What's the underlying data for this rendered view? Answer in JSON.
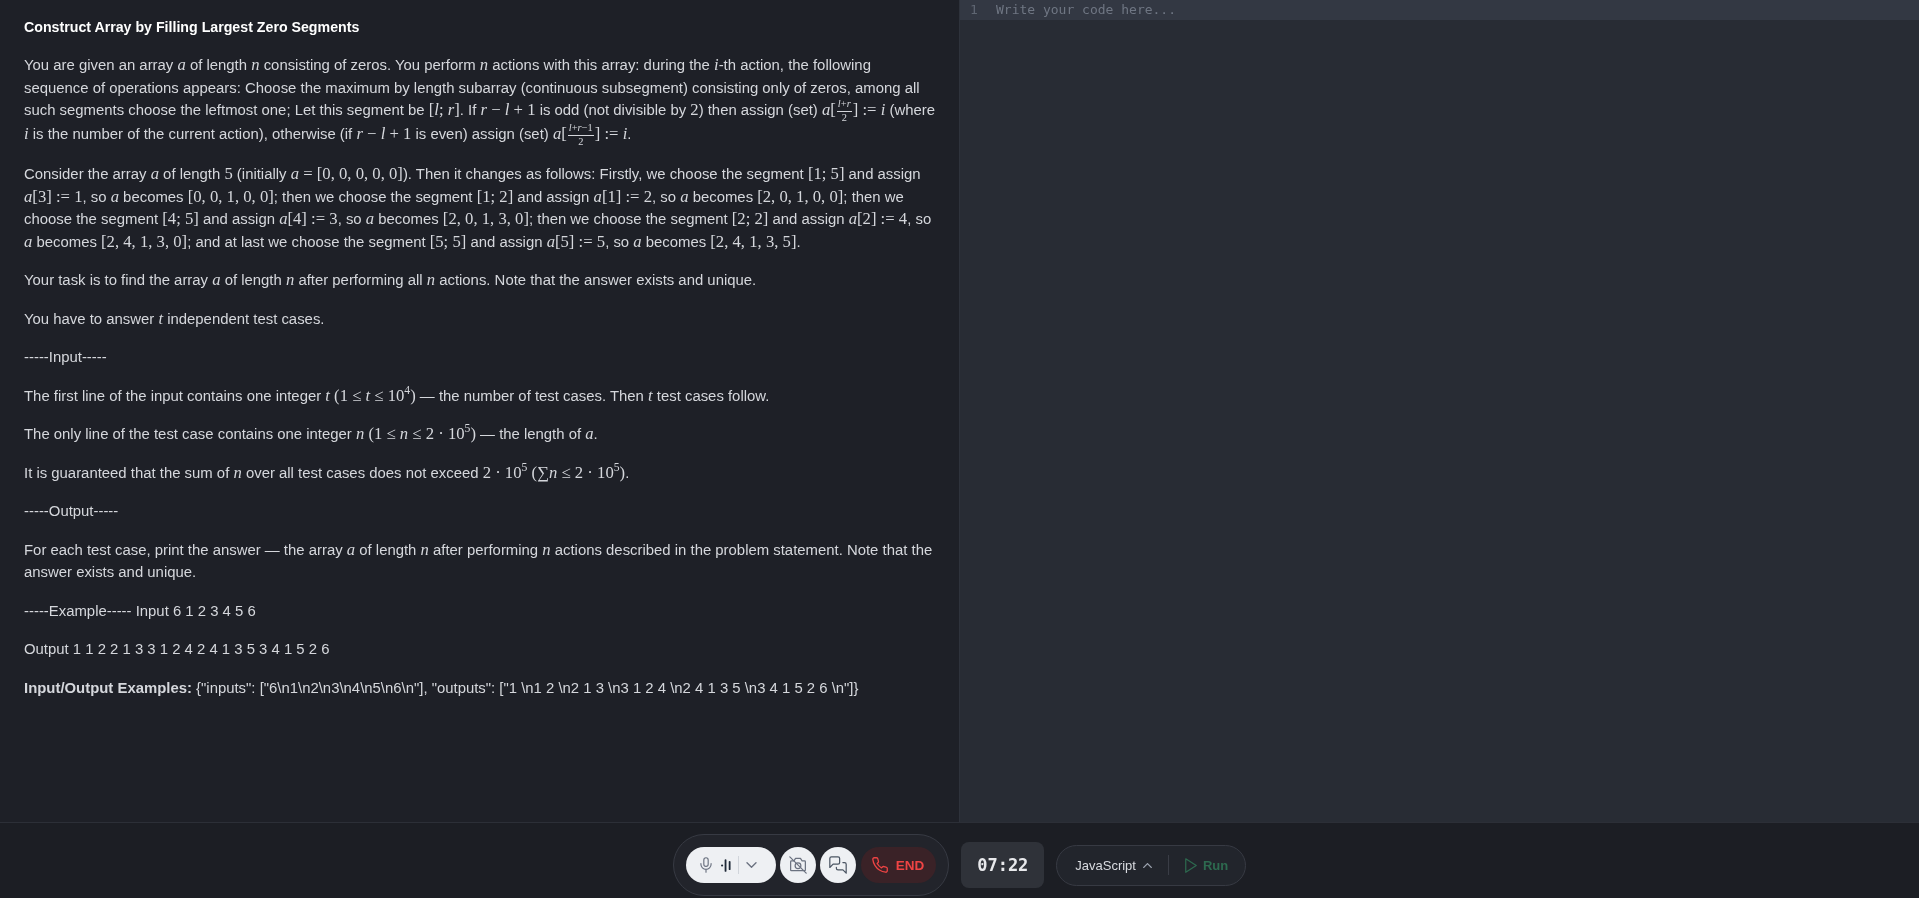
{
  "problem": {
    "title": "Construct Array by Filling Largest Zero Segments",
    "paragraphs": [
      {
        "parts": [
          {
            "kind": "text",
            "text": "You are given an array "
          },
          {
            "kind": "math",
            "text": "*a*"
          },
          {
            "kind": "text",
            "text": " of length "
          },
          {
            "kind": "math",
            "text": "*n*"
          },
          {
            "kind": "text",
            "text": " consisting of zeros. You perform "
          },
          {
            "kind": "math",
            "text": "*n*"
          },
          {
            "kind": "text",
            "text": " actions with this array: during the "
          },
          {
            "kind": "math",
            "text": "*i*"
          },
          {
            "kind": "text",
            "text": "-th action, the following sequence of operations appears: Choose the maximum by length subarray (continuous subsegment) consisting only of zeros, among all such segments choose the leftmost one; Let this segment be "
          },
          {
            "kind": "math",
            "text": "[*l*; *r*]"
          },
          {
            "kind": "text",
            "text": ". If "
          },
          {
            "kind": "math",
            "text": "*r* − *l* + 1"
          },
          {
            "kind": "text",
            "text": " is odd (not divisible by "
          },
          {
            "kind": "math",
            "text": "2"
          },
          {
            "kind": "text",
            "text": ") then assign (set) "
          },
          {
            "kind": "math",
            "text": "*a*["
          },
          {
            "kind": "frac",
            "numerator": "*l*+*r*",
            "denominator": "2"
          },
          {
            "kind": "math",
            "text": "] := *i*"
          },
          {
            "kind": "text",
            "text": " (where "
          },
          {
            "kind": "math",
            "text": "*i*"
          },
          {
            "kind": "text",
            "text": " is the number of the current action), otherwise (if "
          },
          {
            "kind": "math",
            "text": "*r* − *l* + 1"
          },
          {
            "kind": "text",
            "text": " is even) assign (set) "
          },
          {
            "kind": "math",
            "text": "*a*["
          },
          {
            "kind": "frac",
            "numerator": "*l*+*r*−1",
            "denominator": "2"
          },
          {
            "kind": "math",
            "text": "] := *i*"
          },
          {
            "kind": "text",
            "text": "."
          }
        ]
      },
      {
        "parts": [
          {
            "kind": "text",
            "text": "Consider the array "
          },
          {
            "kind": "math",
            "text": "*a*"
          },
          {
            "kind": "text",
            "text": " of length "
          },
          {
            "kind": "math",
            "text": "5"
          },
          {
            "kind": "text",
            "text": " (initially "
          },
          {
            "kind": "math",
            "text": "*a* = [0, 0, 0, 0, 0]"
          },
          {
            "kind": "text",
            "text": "). Then it changes as follows: Firstly, we choose the segment "
          },
          {
            "kind": "math",
            "text": "[1; 5]"
          },
          {
            "kind": "text",
            "text": " and assign "
          },
          {
            "kind": "math",
            "text": "*a*[3] := 1"
          },
          {
            "kind": "text",
            "text": ", so "
          },
          {
            "kind": "math",
            "text": "*a*"
          },
          {
            "kind": "text",
            "text": " becomes "
          },
          {
            "kind": "math",
            "text": "[0, 0, 1, 0, 0]"
          },
          {
            "kind": "text",
            "text": "; then we choose the segment "
          },
          {
            "kind": "math",
            "text": "[1; 2]"
          },
          {
            "kind": "text",
            "text": " and assign "
          },
          {
            "kind": "math",
            "text": "*a*[1] := 2"
          },
          {
            "kind": "text",
            "text": ", so "
          },
          {
            "kind": "math",
            "text": "*a*"
          },
          {
            "kind": "text",
            "text": " becomes "
          },
          {
            "kind": "math",
            "text": "[2, 0, 1, 0, 0]"
          },
          {
            "kind": "text",
            "text": "; then we choose the segment "
          },
          {
            "kind": "math",
            "text": "[4; 5]"
          },
          {
            "kind": "text",
            "text": " and assign "
          },
          {
            "kind": "math",
            "text": "*a*[4] := 3"
          },
          {
            "kind": "text",
            "text": ", so "
          },
          {
            "kind": "math",
            "text": "*a*"
          },
          {
            "kind": "text",
            "text": " becomes "
          },
          {
            "kind": "math",
            "text": "[2, 0, 1, 3, 0]"
          },
          {
            "kind": "text",
            "text": "; then we choose the segment "
          },
          {
            "kind": "math",
            "text": "[2; 2]"
          },
          {
            "kind": "text",
            "text": " and assign "
          },
          {
            "kind": "math",
            "text": "*a*[2] := 4"
          },
          {
            "kind": "text",
            "text": ", so "
          },
          {
            "kind": "math",
            "text": "*a*"
          },
          {
            "kind": "text",
            "text": " becomes "
          },
          {
            "kind": "math",
            "text": "[2, 4, 1, 3, 0]"
          },
          {
            "kind": "text",
            "text": "; and at last we choose the segment "
          },
          {
            "kind": "math",
            "text": "[5; 5]"
          },
          {
            "kind": "text",
            "text": " and assign "
          },
          {
            "kind": "math",
            "text": "*a*[5] := 5"
          },
          {
            "kind": "text",
            "text": ", so "
          },
          {
            "kind": "math",
            "text": "*a*"
          },
          {
            "kind": "text",
            "text": " becomes "
          },
          {
            "kind": "math",
            "text": "[2, 4, 1, 3, 5]"
          },
          {
            "kind": "text",
            "text": "."
          }
        ]
      },
      {
        "parts": [
          {
            "kind": "text",
            "text": "Your task is to find the array "
          },
          {
            "kind": "math",
            "text": "*a*"
          },
          {
            "kind": "text",
            "text": " of length "
          },
          {
            "kind": "math",
            "text": "*n*"
          },
          {
            "kind": "text",
            "text": " after performing all "
          },
          {
            "kind": "math",
            "text": "*n*"
          },
          {
            "kind": "text",
            "text": " actions. Note that the answer exists and unique."
          }
        ]
      },
      {
        "parts": [
          {
            "kind": "text",
            "text": "You have to answer "
          },
          {
            "kind": "math",
            "text": "*t*"
          },
          {
            "kind": "text",
            "text": " independent test cases."
          }
        ]
      },
      {
        "parts": [
          {
            "kind": "text",
            "text": "-----Input-----"
          }
        ]
      },
      {
        "parts": [
          {
            "kind": "text",
            "text": "The first line of the input contains one integer "
          },
          {
            "kind": "math",
            "text": "*t* (1 ≤ *t* ≤ 10$^{4}$)"
          },
          {
            "kind": "text",
            "text": " — the number of test cases. Then "
          },
          {
            "kind": "math",
            "text": "*t*"
          },
          {
            "kind": "text",
            "text": " test cases follow."
          }
        ]
      },
      {
        "parts": [
          {
            "kind": "text",
            "text": "The only line of the test case contains one integer "
          },
          {
            "kind": "math",
            "text": "*n* (1 ≤ *n* ≤ 2 · 10$^{5}$)"
          },
          {
            "kind": "text",
            "text": " — the length of "
          },
          {
            "kind": "math",
            "text": "*a*"
          },
          {
            "kind": "text",
            "text": "."
          }
        ]
      },
      {
        "parts": [
          {
            "kind": "text",
            "text": "It is guaranteed that the sum of "
          },
          {
            "kind": "math",
            "text": "*n*"
          },
          {
            "kind": "text",
            "text": " over all test cases does not exceed "
          },
          {
            "kind": "math",
            "text": "2 · 10$^{5}$ (∑*n* ≤ 2 · 10$^{5}$)"
          },
          {
            "kind": "text",
            "text": "."
          }
        ]
      },
      {
        "parts": [
          {
            "kind": "text",
            "text": "-----Output-----"
          }
        ]
      },
      {
        "parts": [
          {
            "kind": "text",
            "text": "For each test case, print the answer — the array "
          },
          {
            "kind": "math",
            "text": "*a*"
          },
          {
            "kind": "text",
            "text": " of length "
          },
          {
            "kind": "math",
            "text": "*n*"
          },
          {
            "kind": "text",
            "text": " after performing "
          },
          {
            "kind": "math",
            "text": "*n*"
          },
          {
            "kind": "text",
            "text": " actions described in the problem statement. Note that the answer exists and unique."
          }
        ]
      },
      {
        "parts": [
          {
            "kind": "text",
            "text": "-----Example----- Input 6 1 2 3 4 5 6"
          }
        ]
      },
      {
        "parts": [
          {
            "kind": "text",
            "text": "Output 1 1 2 2 1 3 3 1 2 4 2 4 1 3 5 3 4 1 5 2 6"
          }
        ]
      },
      {
        "parts": [
          {
            "kind": "text",
            "text": "**Input/Output Examples:** {\"inputs\": [\"6\\n1\\n2\\n3\\n4\\n5\\n6\\n\"], \"outputs\": [\"1 \\n1 2 \\n2 1 3 \\n3 1 2 4 \\n2 4 1 3 5 \\n3 4 1 5 2 6 \\n\"]}"
          }
        ]
      }
    ]
  },
  "editor": {
    "placeholder": "Write your code here...",
    "lines": [
      {
        "number": "1",
        "active": true
      }
    ]
  },
  "call_controls": {
    "mic_on": true,
    "camera_on": false,
    "end_label": "END"
  },
  "timer": "07:22",
  "language_selector": {
    "label": "JavaScript"
  },
  "run_button": {
    "label": "Run",
    "disabled": true
  }
}
